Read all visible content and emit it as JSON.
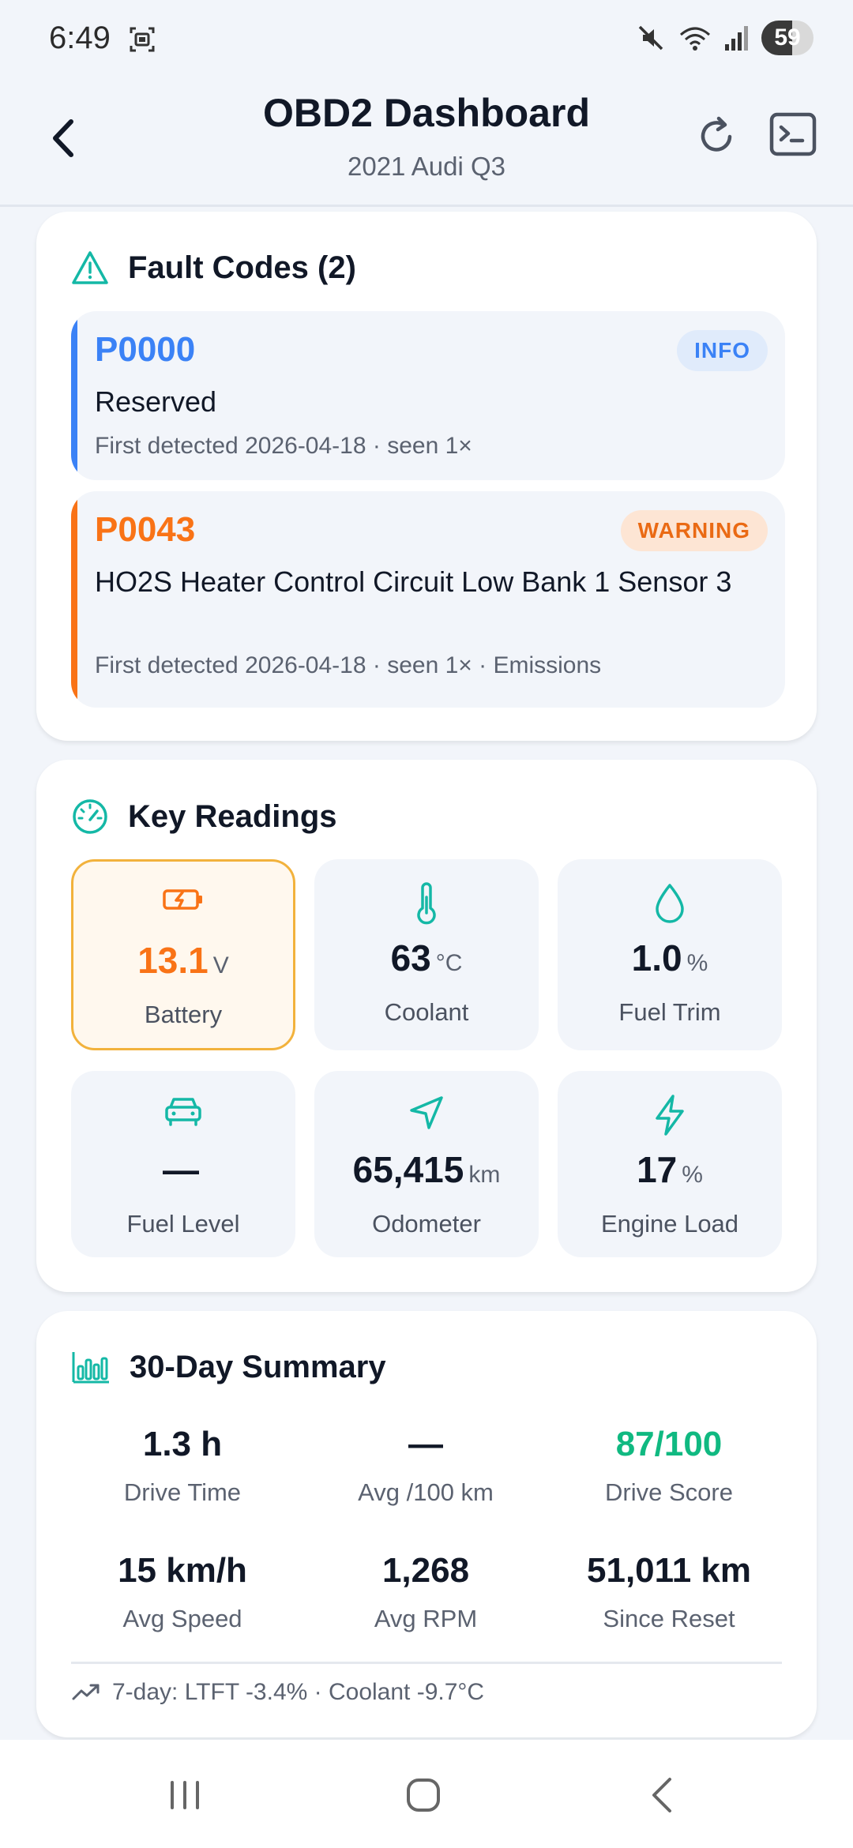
{
  "status_bar": {
    "time": "6:49",
    "battery": "59",
    "battery_level": 0.59
  },
  "header": {
    "title": "OBD2 Dashboard",
    "subtitle": "2021 Audi Q3"
  },
  "fault_codes": {
    "title": "Fault Codes (2)",
    "items": [
      {
        "code": "P0000",
        "badge": "INFO",
        "description": "Reserved",
        "meta": "First detected 2026-04-18 · seen 1×",
        "color": "#3b82f6"
      },
      {
        "code": "P0043",
        "badge": "WARNING",
        "description": "HO2S Heater Control Circuit Low Bank 1 Sensor 3",
        "meta": "First detected 2026-04-18 · seen 1× · Emissions",
        "color": "#f97316"
      }
    ]
  },
  "key_readings": {
    "title": "Key Readings",
    "tiles": [
      {
        "icon": "battery-charging-icon",
        "value": "13.1",
        "unit": "V",
        "label": "Battery"
      },
      {
        "icon": "thermometer-icon",
        "value": "63",
        "unit": "°C",
        "label": "Coolant"
      },
      {
        "icon": "droplet-icon",
        "value": "1.0",
        "unit": "%",
        "label": "Fuel Trim"
      },
      {
        "icon": "car-icon",
        "value": "—",
        "unit": "",
        "label": "Fuel Level"
      },
      {
        "icon": "navigation-icon",
        "value": "65,415",
        "unit": "km",
        "label": "Odometer"
      },
      {
        "icon": "lightning-icon",
        "value": "17",
        "unit": "%",
        "label": "Engine Load"
      }
    ]
  },
  "summary": {
    "title": "30-Day Summary",
    "stats": [
      {
        "value": "1.3 h",
        "label": "Drive Time"
      },
      {
        "value": "—",
        "label": "Avg /100 km"
      },
      {
        "value": "87/100",
        "label": "Drive Score"
      },
      {
        "value": "15 km/h",
        "label": "Avg Speed"
      },
      {
        "value": "1,268",
        "label": "Avg RPM"
      },
      {
        "value": "51,011 km",
        "label": "Since Reset"
      }
    ],
    "trend": "7-day: LTFT -3.4% · Coolant -9.7°C"
  },
  "colors": {
    "accent_teal": "#14b8a6",
    "info_blue": "#3b82f6",
    "warning_orange": "#f97316",
    "score_green": "#10b981",
    "battery_amber": "#f59e0b"
  }
}
